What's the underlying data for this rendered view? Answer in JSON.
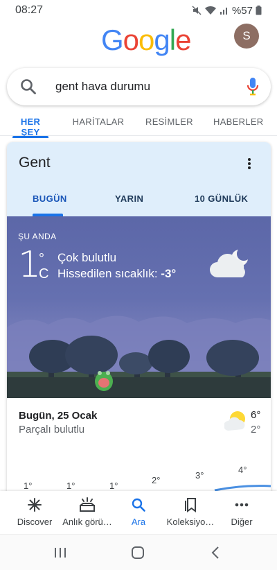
{
  "status_bar": {
    "time": "08:27",
    "battery": "%57"
  },
  "google_logo": {
    "letters": [
      "G",
      "o",
      "o",
      "g",
      "l",
      "e"
    ],
    "colors": [
      "#4285F4",
      "#EA4335",
      "#FBBC05",
      "#4285F4",
      "#34A853",
      "#EA4335"
    ]
  },
  "account": {
    "initial": "S"
  },
  "search": {
    "query": "gent hava durumu"
  },
  "tabs": [
    {
      "label": "HER ŞEY",
      "active": true
    },
    {
      "label": "HARİTALAR",
      "active": false
    },
    {
      "label": "RESİMLER",
      "active": false
    },
    {
      "label": "HABERLER",
      "active": false
    }
  ],
  "weather": {
    "city": "Gent",
    "day_tabs": [
      {
        "label": "BUGÜN",
        "active": true
      },
      {
        "label": "YARIN",
        "active": false
      },
      {
        "label": "10 GÜNLÜK",
        "active": false
      }
    ],
    "now_label": "ŞU ANDA",
    "current_temp": "1",
    "degree_symbol": "°",
    "unit": "C",
    "condition": "Çok bulutlu",
    "feels_like_label": "Hissedilen sıcaklık:",
    "feels_like_value": "-3°",
    "today": {
      "date": "Bugün, 25 Ocak",
      "condition": "Parçalı bulutlu",
      "high": "6°",
      "low": "2°"
    },
    "hourly_temps": [
      "1°",
      "1°",
      "1°",
      "2°",
      "3°",
      "4°"
    ],
    "colors": {
      "sky": "#5c67a8",
      "accent": "#1a73e8"
    }
  },
  "bottom_nav": [
    {
      "label": "Discover",
      "icon": "asterisk-icon",
      "active": false
    },
    {
      "label": "Anlık görü…",
      "icon": "updates-icon",
      "active": false
    },
    {
      "label": "Ara",
      "icon": "search-icon",
      "active": true
    },
    {
      "label": "Koleksiyo…",
      "icon": "collections-icon",
      "active": false
    },
    {
      "label": "Diğer",
      "icon": "more-icon",
      "active": false
    }
  ]
}
